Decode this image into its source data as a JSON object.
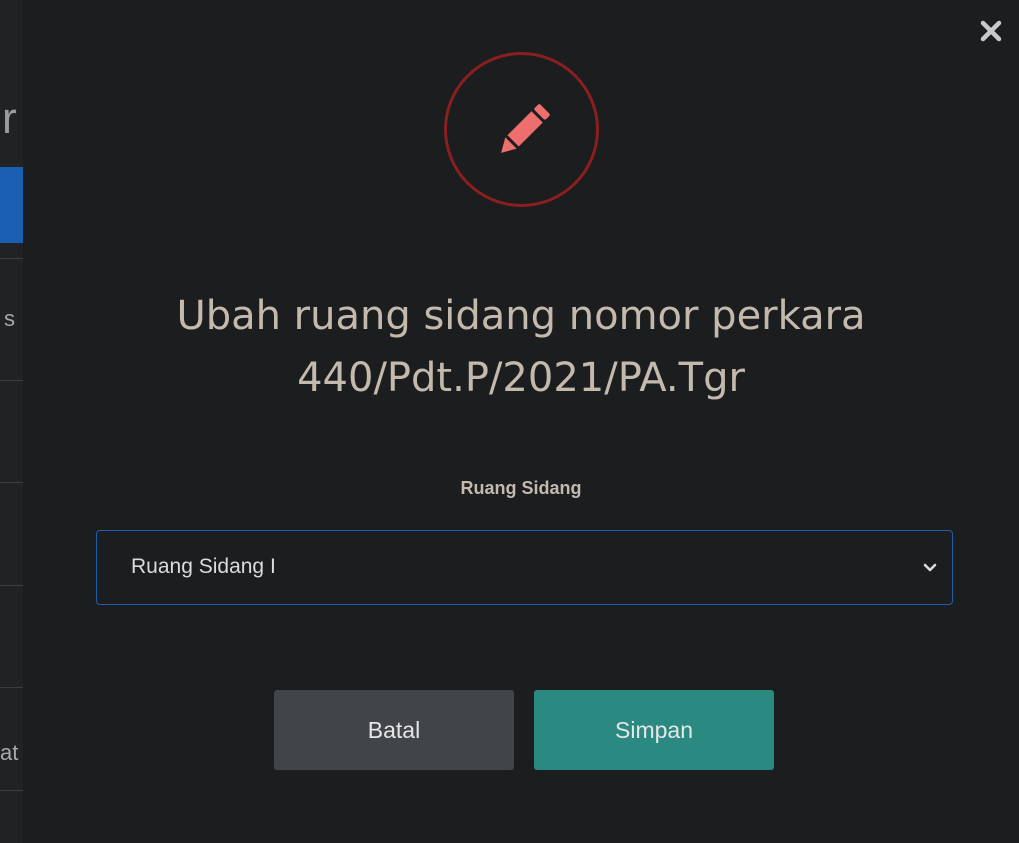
{
  "background": {
    "fragment_top": "r",
    "fragment_middle": "s",
    "fragment_bottom": "at",
    "accent_blue": "#1a5fb4"
  },
  "modal": {
    "close_icon": "close-icon",
    "header_icon": "pencil-icon",
    "title_line1": "Ubah ruang sidang nomor perkara",
    "title_line2": "440/Pdt.P/2021/PA.Tgr",
    "field_label": "Ruang Sidang",
    "select_value": "Ruang Sidang I",
    "cancel_label": "Batal",
    "save_label": "Simpan",
    "colors": {
      "modal_bg": "#1b1d1f",
      "icon_ring": "#8b1e1e",
      "icon_fill": "#ee6e6e",
      "title_text": "#c4b9ad",
      "select_border": "#1f5ea8",
      "cancel_bg": "#414549",
      "save_bg": "#2a8a82"
    }
  }
}
